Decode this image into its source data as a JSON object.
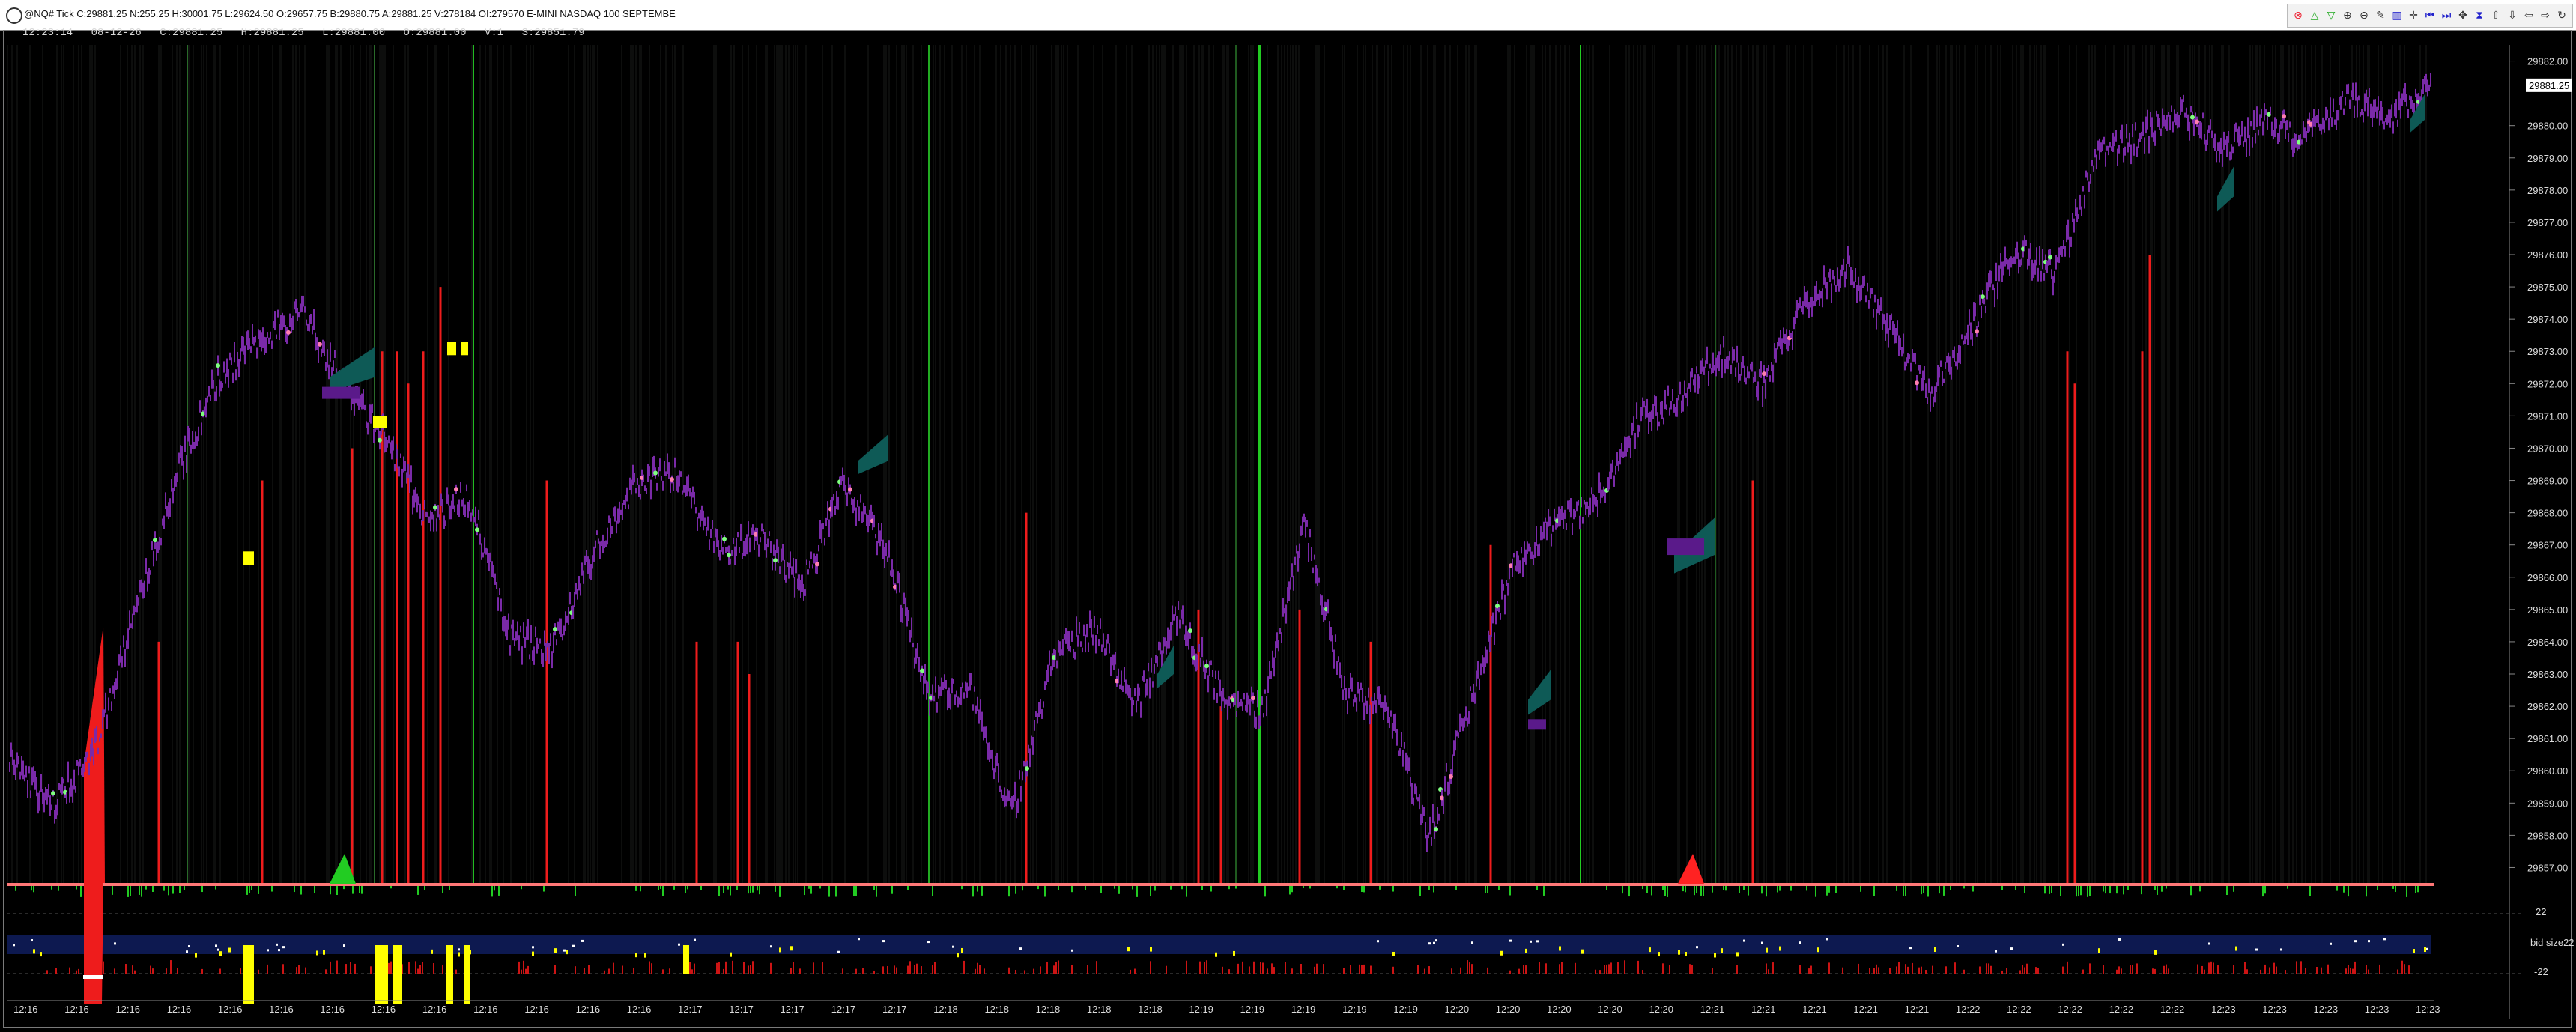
{
  "window": {
    "title": "@NQ# Tick  C:29881.25  N:255.25  H:30001.75  L:29624.50  O:29657.75  B:29880.75  A:29881.25  V:278184  OI:279570  E-MINI NASDAQ 100 SEPTEMBE"
  },
  "toolbar": {
    "buttons": [
      "cursor-icon",
      "triangle-up-icon",
      "triangle-down-icon",
      "zoom-in-icon",
      "zoom-out-icon",
      "drawing-icon",
      "bars-icon",
      "crosshair-icon",
      "scroll-left-icon",
      "scroll-right-icon",
      "pan-icon",
      "chart-type-icon",
      "arrow-up-icon",
      "arrow-down-icon",
      "back-icon",
      "forward-icon",
      "refresh-icon"
    ]
  },
  "info_line": {
    "time": "12:23:14",
    "date": "08-12-26",
    "close": "C:29881.25",
    "high": "H:29881.25",
    "low": "L:29881.00",
    "open": "O:29881.00",
    "volume": "V:1",
    "s": "S:29851.79"
  },
  "price_axis": {
    "labels": [
      "29882.00",
      "29881.25",
      "29880.00",
      "29879.00",
      "29878.00",
      "29877.00",
      "29876.00",
      "29875.00",
      "29874.00",
      "29873.00",
      "29872.00",
      "29871.00",
      "29870.00",
      "29869.00",
      "29868.00",
      "29867.00",
      "29866.00",
      "29865.00",
      "29864.00",
      "29863.00",
      "29862.00",
      "29861.00",
      "29860.00",
      "29859.00",
      "29858.00",
      "29857.00"
    ],
    "current_price": "29881.25"
  },
  "sub_panels": {
    "bid_size_label": "bid size22",
    "level_a": "22",
    "level_b": "-22"
  },
  "time_axis": {
    "labels": [
      "12:16",
      "12:16",
      "12:16",
      "12:16",
      "12:16",
      "12:16",
      "12:16",
      "12:16",
      "12:16",
      "12:16",
      "12:16",
      "12:16",
      "12:16",
      "12:17",
      "12:17",
      "12:17",
      "12:17",
      "12:17",
      "12:18",
      "12:18",
      "12:18",
      "12:18",
      "12:18",
      "12:19",
      "12:19",
      "12:19",
      "12:19",
      "12:19",
      "12:20",
      "12:20",
      "12:20",
      "12:20",
      "12:20",
      "12:21",
      "12:21",
      "12:21",
      "12:21",
      "12:21",
      "12:22",
      "12:22",
      "12:22",
      "12:22",
      "12:22",
      "12:23",
      "12:23",
      "12:23",
      "12:23",
      "12:23"
    ]
  },
  "chart_data": {
    "type": "line",
    "title": "",
    "symbol": "@NQ# Tick",
    "ylim": [
      29856.5,
      29882.5
    ],
    "x": [
      "12:16",
      "12:17",
      "12:18",
      "12:19",
      "12:20",
      "12:21",
      "12:22",
      "12:23"
    ],
    "price_path": [
      29860.4,
      29858.9,
      29860.5,
      29864.8,
      29869.2,
      29872.2,
      29873.4,
      29874.2,
      29872.0,
      29870.3,
      29867.8,
      29868.5,
      29864.1,
      29863.8,
      29866.8,
      29868.9,
      29869.2,
      29866.8,
      29867.2,
      29865.8,
      29868.9,
      29866.8,
      29862.3,
      29862.6,
      29858.6,
      29863.6,
      29864.4,
      29862.1,
      29864.8,
      29862.4,
      29861.8,
      29867.7,
      29862.4,
      29862.0,
      29857.9,
      29862.2,
      29866.4,
      29867.6,
      29868.4,
      29870.8,
      29871.6,
      29872.9,
      29872.0,
      29874.4,
      29875.6,
      29873.8,
      29871.7,
      29873.8,
      29876.2,
      29875.4,
      29879.1,
      29879.6,
      29880.5,
      29879.3,
      29880.1,
      29879.6,
      29880.9,
      29880.3,
      29881.2
    ],
    "colors": {
      "bars": "#7a2aa8",
      "teal_blocks": "#0e5a56",
      "up_spikes": "#ee1c1c",
      "green_lines": "#22cc22",
      "yellow_marks": "#ffff00",
      "bid_band": "#0d1950"
    }
  }
}
